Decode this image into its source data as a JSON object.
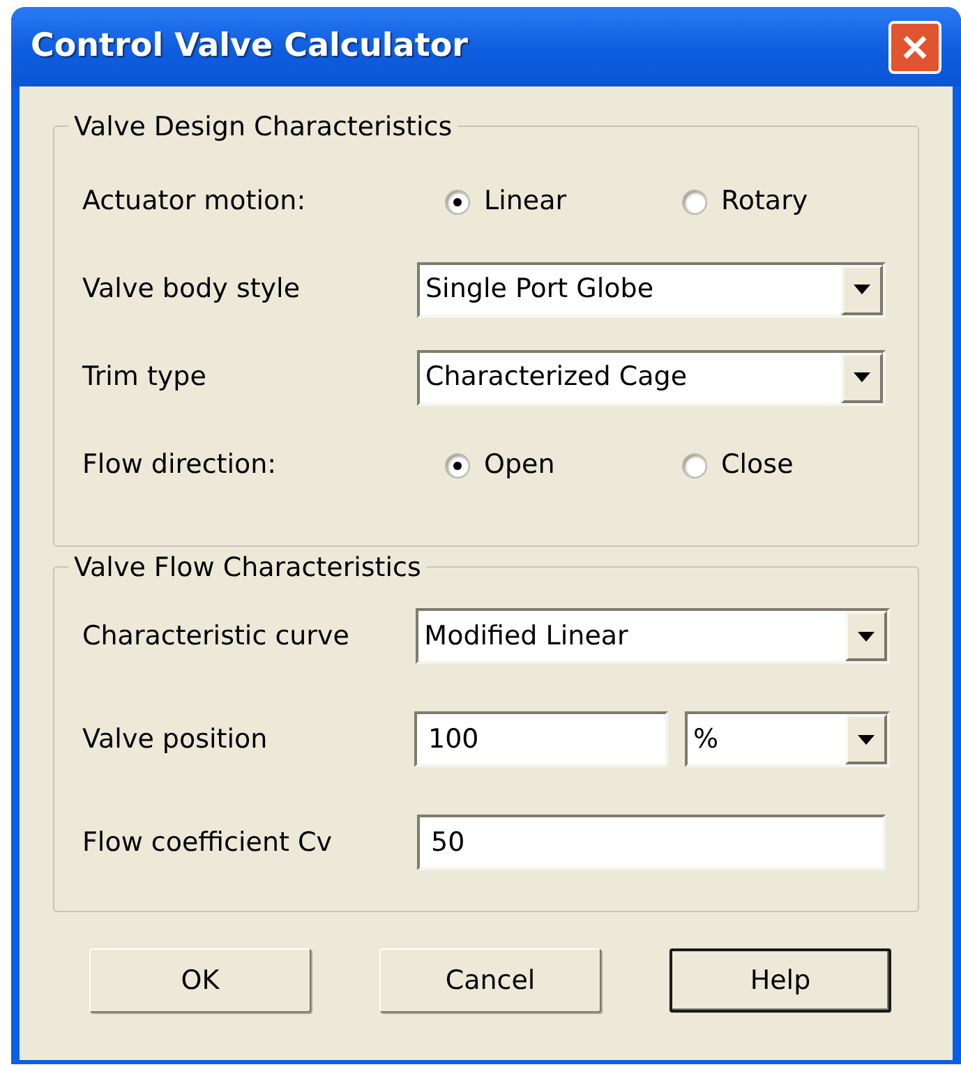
{
  "window": {
    "title": "Control Valve Calculator"
  },
  "groups": [
    {
      "title": "Valve Design Characteristics",
      "rows": [
        {
          "kind": "radio",
          "label": "Actuator motion:",
          "options": [
            {
              "label": "Linear",
              "selected": true
            },
            {
              "label": "Rotary",
              "selected": false
            }
          ]
        },
        {
          "kind": "dropdown",
          "label": "Valve body style",
          "value": "Single Port Globe"
        },
        {
          "kind": "dropdown",
          "label": "Trim type",
          "value": "Characterized Cage"
        },
        {
          "kind": "radio",
          "label": "Flow direction:",
          "options": [
            {
              "label": "Open",
              "selected": true
            },
            {
              "label": "Close",
              "selected": false
            }
          ]
        }
      ]
    },
    {
      "title": "Valve Flow Characteristics",
      "rows": [
        {
          "kind": "dropdown",
          "label": "Characteristic curve",
          "value": "Modified Linear"
        },
        {
          "kind": "text_unit",
          "label": "Valve position",
          "value": "100",
          "unit": "%"
        },
        {
          "kind": "text",
          "label": "Flow coefficient Cv",
          "value": "50"
        }
      ]
    }
  ],
  "buttons": [
    {
      "label": "OK",
      "default": false
    },
    {
      "label": "Cancel",
      "default": false
    },
    {
      "label": "Help",
      "default": true
    }
  ]
}
